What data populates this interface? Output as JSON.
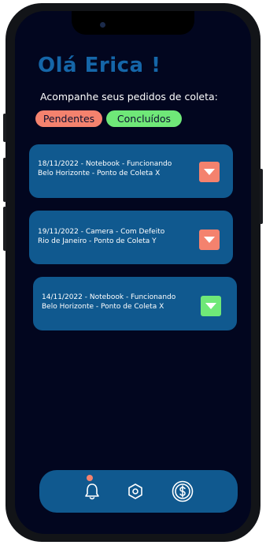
{
  "header": {
    "greeting": "Olá Erica !",
    "subtitle": "Acompanhe seus pedidos de coleta:"
  },
  "filters": {
    "pending": "Pendentes",
    "completed": "Concluídos"
  },
  "orders": [
    {
      "line1": "18/11/2022 - Notebook - Funcionando",
      "line2": "Belo Horizonte - Ponto de Coleta X",
      "status": "pendente",
      "status_color": "#f4826e"
    },
    {
      "line1": "19/11/2022 - Camera - Com Defeito",
      "line2": "Rio de Janeiro - Ponto de Coleta Y",
      "status": "pendente",
      "status_color": "#f4826e"
    },
    {
      "line1": "14/11/2022 - Notebook - Funcionando",
      "line2": "Belo Horizonte - Ponto de Coleta X",
      "status": "concluido",
      "status_color": "#6fe878"
    }
  ],
  "nav": {
    "items": [
      "bell-icon",
      "settings-icon",
      "dollar-icon"
    ],
    "notification_badge_color": "#f4826e"
  },
  "colors": {
    "background": "#02061f",
    "accent": "#1566a8",
    "card": "#10598f"
  }
}
